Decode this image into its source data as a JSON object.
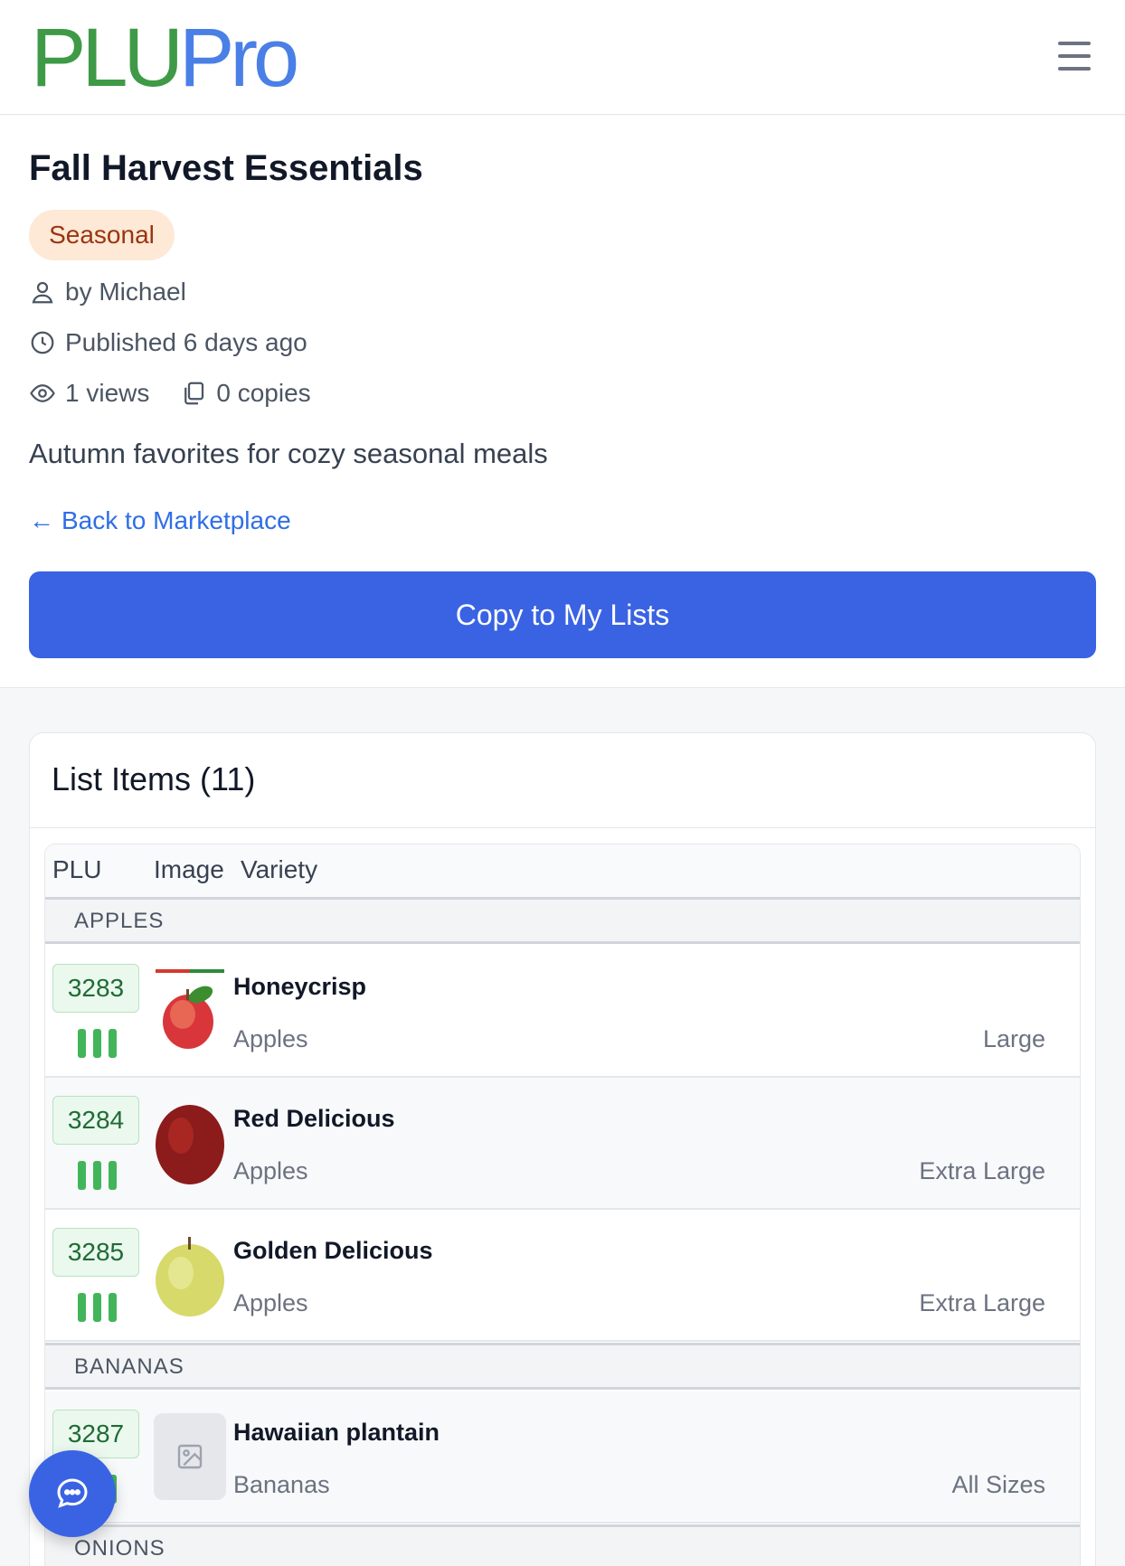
{
  "header": {
    "logo_part1": "PLU",
    "logo_part2": "Pro",
    "menu_icon": "hamburger-menu-icon"
  },
  "list": {
    "title": "Fall Harvest Essentials",
    "badge": "Seasonal",
    "author": "by Michael",
    "published": "Published 6 days ago",
    "views": "1 views",
    "copies": "0 copies",
    "description": "Autumn favorites for cozy seasonal meals",
    "back_link": "Back to Marketplace",
    "copy_button": "Copy to My Lists"
  },
  "items_card": {
    "title": "List Items (11)",
    "columns": {
      "plu": "PLU",
      "image": "Image",
      "variety": "Variety"
    },
    "groups": [
      {
        "name": "APPLES"
      },
      {
        "name": "BANANAS"
      },
      {
        "name": "ONIONS"
      }
    ],
    "rows": [
      {
        "plu": "3283",
        "variety": "Honeycrisp",
        "category": "Apples",
        "size": "Large",
        "image": "honeycrisp-apple"
      },
      {
        "plu": "3284",
        "variety": "Red Delicious",
        "category": "Apples",
        "size": "Extra Large",
        "image": "red-delicious-apple"
      },
      {
        "plu": "3285",
        "variety": "Golden Delicious",
        "category": "Apples",
        "size": "Extra Large",
        "image": "golden-delicious-apple"
      },
      {
        "plu": "3287",
        "variety": "Hawaiian plantain",
        "category": "Bananas",
        "size": "All Sizes",
        "image": "image-placeholder-icon"
      }
    ]
  },
  "colors": {
    "brand_green": "#3f9a47",
    "brand_blue": "#4a7fe6",
    "primary_button": "#3a63e3",
    "badge_bg": "#fde9d5",
    "badge_text": "#9a3412"
  }
}
